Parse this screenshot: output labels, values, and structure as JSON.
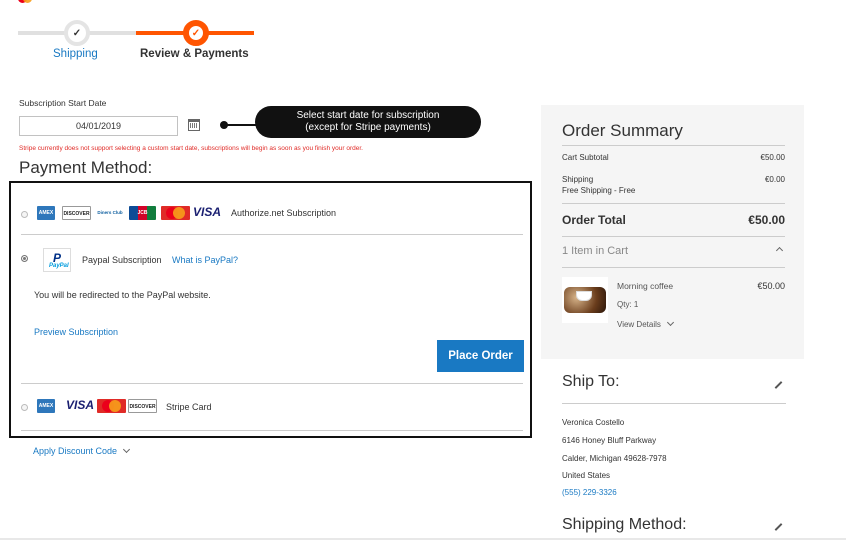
{
  "brand_colors": {
    "accent": "#ff5501",
    "link": "#1979c3",
    "error": "#e02b27",
    "button": "#1979c3"
  },
  "progress": {
    "steps": [
      {
        "label": "Shipping",
        "state": "complete"
      },
      {
        "label": "Review & Payments",
        "state": "active"
      }
    ],
    "check_icon": "✓"
  },
  "subscription": {
    "label": "Subscription Start Date",
    "date_value": "04/01/2019",
    "callout_line1": "Select start date for subscription",
    "callout_line2": "(except for Stripe payments)",
    "stripe_warning": "Stripe currently does not support selecting a custom start date, subscriptions will begin as soon as you finish your order."
  },
  "payment": {
    "title": "Payment Method:",
    "methods": [
      {
        "name": "Authorize.net Subscription",
        "selected": false,
        "cards": [
          "AMEX",
          "DISCOVER",
          "Diners Club",
          "JCB",
          "MasterCard",
          "VISA"
        ]
      },
      {
        "name": "Paypal Subscription",
        "selected": true,
        "link": "What is PayPal?",
        "paypal_p": "P",
        "paypal_text": "PayPal",
        "redirect_note": "You will be redirected to the PayPal website.",
        "preview_link": "Preview Subscription",
        "place_order": "Place Order"
      },
      {
        "name": "Stripe Card",
        "selected": false,
        "cards": [
          "AMEX",
          "VISA",
          "MasterCard",
          "DISCOVER"
        ]
      }
    ],
    "discount_link": "Apply Discount Code"
  },
  "summary": {
    "title": "Order Summary",
    "cart_subtotal_label": "Cart Subtotal",
    "cart_subtotal": "€50.00",
    "shipping_label": "Shipping",
    "shipping_value": "€0.00",
    "shipping_method": "Free Shipping - Free",
    "order_total_label": "Order Total",
    "order_total": "€50.00",
    "items_in_cart": "1 Item in Cart",
    "item": {
      "name": "Morning coffee",
      "price": "€50.00",
      "qty": "Qty: 1",
      "details": "View Details"
    }
  },
  "ship_to": {
    "title": "Ship To:",
    "name": "Veronica Costello",
    "street": "6146 Honey Bluff Parkway",
    "city": "Calder, Michigan 49628-7978",
    "country": "United States",
    "phone": "(555) 229-3326"
  },
  "shipping_method": {
    "title": "Shipping Method:"
  }
}
